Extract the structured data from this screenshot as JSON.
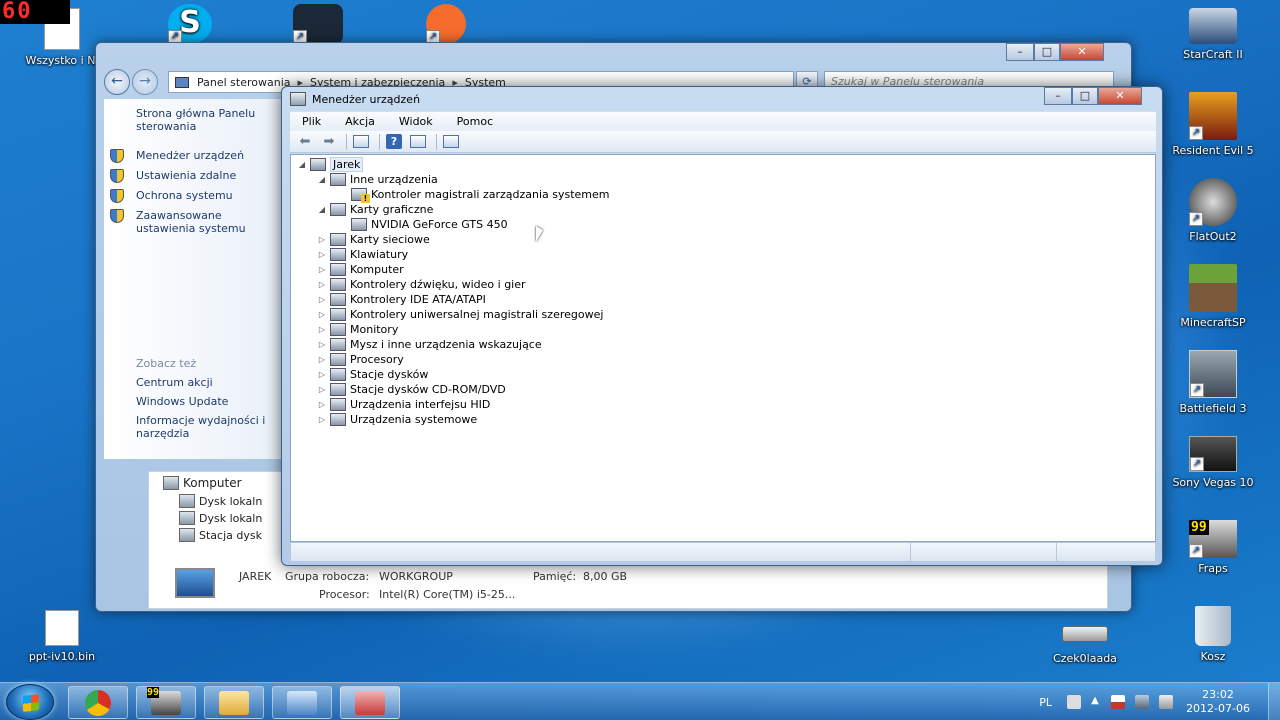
{
  "fps_counter": "60",
  "desktop": {
    "left_icons": [
      {
        "label": "Wszystko i Ni",
        "name": "desktop-icon-wszystko"
      },
      {
        "label": "ppt-iv10.bin",
        "name": "desktop-icon-ppt"
      }
    ],
    "top_icons": [
      {
        "label": "Skype",
        "name": "desktop-icon-skype",
        "color": "#00aff0"
      },
      {
        "label": "Steam",
        "name": "desktop-icon-steam",
        "color": "#1b2838"
      },
      {
        "label": "Origin",
        "name": "desktop-icon-origin",
        "color": "#f56c2d"
      }
    ],
    "right_icons": [
      {
        "label": "StarCraft II",
        "name": "desktop-icon-starcraft",
        "color": "#2b4d7a"
      },
      {
        "label": "Resident Evil 5",
        "name": "desktop-icon-resident-evil",
        "color": "#7a1c10"
      },
      {
        "label": "FlatOut2",
        "name": "desktop-icon-flatout",
        "color": "#444444"
      },
      {
        "label": "MinecraftSP",
        "name": "desktop-icon-minecraft",
        "color": "#5a8a2e"
      },
      {
        "label": "Battlefield 3",
        "name": "desktop-icon-battlefield",
        "color": "#3a4a56"
      },
      {
        "label": "Sony Vegas 10",
        "name": "desktop-icon-vegas",
        "color": "#222222"
      },
      {
        "label": "Fraps",
        "name": "desktop-icon-fraps",
        "color": "#333333",
        "badge": "99"
      },
      {
        "label": "Kosz",
        "name": "desktop-icon-recycle-bin",
        "color": "#b7c4d3"
      }
    ],
    "drive_icon": {
      "label": "Czek0laada",
      "name": "desktop-icon-czekolada"
    }
  },
  "control_panel": {
    "breadcrumb": [
      "Panel sterowania",
      "System i zabezpieczenia",
      "System"
    ],
    "search_placeholder": "Szukaj w Panelu sterowania",
    "home_link": "Strona główna Panelu sterowania",
    "tasks": [
      "Menedżer urządzeń",
      "Ustawienia zdalne",
      "Ochrona systemu",
      "Zaawansowane ustawienia systemu"
    ],
    "see_also_heading": "Zobacz też",
    "see_also": [
      "Centrum akcji",
      "Windows Update",
      "Informacje wydajności i narzędzia"
    ],
    "tree": [
      "Komputer",
      "Dysk lokaln",
      "Dysk lokaln",
      "Stacja dysk"
    ],
    "computer_name": "JAREK",
    "workgroup_label": "Grupa robocza:",
    "workgroup_value": "WORKGROUP",
    "memory_label": "Pamięć:",
    "memory_value": "8,00 GB",
    "cpu_label": "Procesor:",
    "cpu_value": "Intel(R) Core(TM) i5-25..."
  },
  "device_manager": {
    "title": "Menedżer urządzeń",
    "menu": [
      "Plik",
      "Akcja",
      "Widok",
      "Pomoc"
    ],
    "root": "Jarek",
    "nodes": [
      {
        "label": "Inne urządzenia",
        "level": 1,
        "expanded": true
      },
      {
        "label": "Kontroler magistrali zarządzania systemem",
        "level": 2,
        "warn": true
      },
      {
        "label": "Karty graficzne",
        "level": 1,
        "expanded": true
      },
      {
        "label": "NVIDIA GeForce GTS 450",
        "level": 2
      },
      {
        "label": "Karty sieciowe",
        "level": 1
      },
      {
        "label": "Klawiatury",
        "level": 1
      },
      {
        "label": "Komputer",
        "level": 1
      },
      {
        "label": "Kontrolery dźwięku, wideo i gier",
        "level": 1
      },
      {
        "label": "Kontrolery IDE ATA/ATAPI",
        "level": 1
      },
      {
        "label": "Kontrolery uniwersalnej magistrali szeregowej",
        "level": 1
      },
      {
        "label": "Monitory",
        "level": 1
      },
      {
        "label": "Mysz i inne urządzenia wskazujące",
        "level": 1
      },
      {
        "label": "Procesory",
        "level": 1
      },
      {
        "label": "Stacje dysków",
        "level": 1
      },
      {
        "label": "Stacje dysków CD-ROM/DVD",
        "level": 1
      },
      {
        "label": "Urządzenia interfejsu HID",
        "level": 1
      },
      {
        "label": "Urządzenia systemowe",
        "level": 1
      }
    ]
  },
  "taskbar": {
    "language": "PL",
    "time": "23:02",
    "date": "2012-07-06",
    "fraps_badge": "99",
    "buttons": [
      {
        "name": "taskbar-chrome",
        "color": "#d93025"
      },
      {
        "name": "taskbar-fraps",
        "color": "#333333"
      },
      {
        "name": "taskbar-explorer",
        "color": "#f0c75e"
      },
      {
        "name": "taskbar-control-panel",
        "color": "#4c86c6"
      },
      {
        "name": "taskbar-device-manager",
        "color": "#c73a3a"
      }
    ]
  }
}
